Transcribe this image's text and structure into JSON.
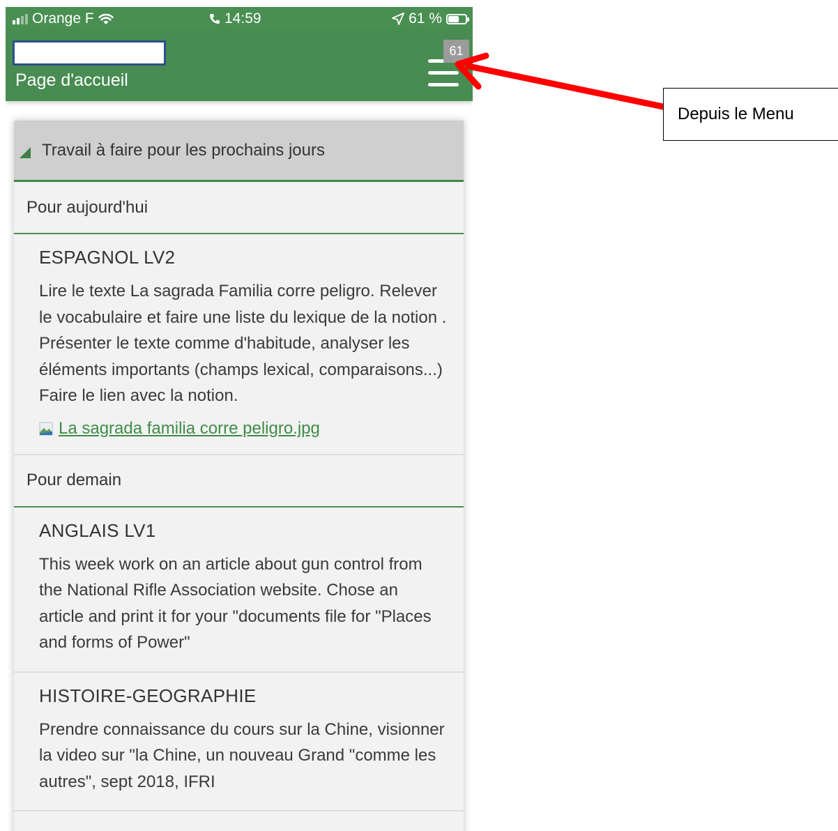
{
  "status_bar": {
    "carrier": "Orange F",
    "time": "14:59",
    "battery": "61 %",
    "battery_level": 0.61
  },
  "header": {
    "title": "Page d'accueil",
    "menu_badge": "61"
  },
  "card": {
    "title": "Travail à faire pour les prochains jours",
    "sections": [
      {
        "heading": "Pour aujourd'hui",
        "items": [
          {
            "subject": "ESPAGNOL LV2",
            "description": "Lire le texte La sagrada Familia corre peligro. Relever le vocabulaire et faire une liste du lexique de la notion . Présenter le texte comme d'habitude, analyser les éléments importants (champs lexical, comparaisons...) Faire le lien avec la notion.",
            "attachment": "La sagrada familia corre peligro.jpg"
          }
        ]
      },
      {
        "heading": "Pour demain",
        "items": [
          {
            "subject": "ANGLAIS LV1",
            "description": "This week work on an article about gun control from the National Rifle Association website. Chose an article and print it for your \"documents file for \"Places and forms of Power\""
          },
          {
            "subject": "HISTOIRE-GEOGRAPHIE",
            "description": "Prendre connaissance du cours sur la Chine, visionner la video sur \"la Chine, un nouveau Grand \"comme les autres\", sept 2018, IFRI"
          }
        ]
      }
    ]
  },
  "annotation": {
    "label": "Depuis le Menu",
    "arrow_color": "#ff0000"
  },
  "colors": {
    "header_green": "#488c51",
    "link_green": "#3e8c47",
    "card_bg": "#f2f2f2"
  }
}
